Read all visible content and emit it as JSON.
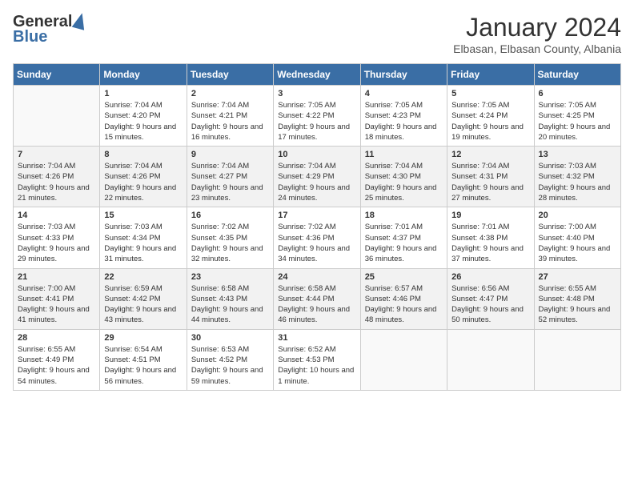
{
  "header": {
    "logo_general": "General",
    "logo_blue": "Blue",
    "title": "January 2024",
    "subtitle": "Elbasan, Elbasan County, Albania"
  },
  "weekdays": [
    "Sunday",
    "Monday",
    "Tuesday",
    "Wednesday",
    "Thursday",
    "Friday",
    "Saturday"
  ],
  "weeks": [
    [
      {
        "day": "",
        "sunrise": "",
        "sunset": "",
        "daylight": ""
      },
      {
        "day": "1",
        "sunrise": "Sunrise: 7:04 AM",
        "sunset": "Sunset: 4:20 PM",
        "daylight": "Daylight: 9 hours and 15 minutes."
      },
      {
        "day": "2",
        "sunrise": "Sunrise: 7:04 AM",
        "sunset": "Sunset: 4:21 PM",
        "daylight": "Daylight: 9 hours and 16 minutes."
      },
      {
        "day": "3",
        "sunrise": "Sunrise: 7:05 AM",
        "sunset": "Sunset: 4:22 PM",
        "daylight": "Daylight: 9 hours and 17 minutes."
      },
      {
        "day": "4",
        "sunrise": "Sunrise: 7:05 AM",
        "sunset": "Sunset: 4:23 PM",
        "daylight": "Daylight: 9 hours and 18 minutes."
      },
      {
        "day": "5",
        "sunrise": "Sunrise: 7:05 AM",
        "sunset": "Sunset: 4:24 PM",
        "daylight": "Daylight: 9 hours and 19 minutes."
      },
      {
        "day": "6",
        "sunrise": "Sunrise: 7:05 AM",
        "sunset": "Sunset: 4:25 PM",
        "daylight": "Daylight: 9 hours and 20 minutes."
      }
    ],
    [
      {
        "day": "7",
        "sunrise": "Sunrise: 7:04 AM",
        "sunset": "Sunset: 4:26 PM",
        "daylight": "Daylight: 9 hours and 21 minutes."
      },
      {
        "day": "8",
        "sunrise": "Sunrise: 7:04 AM",
        "sunset": "Sunset: 4:26 PM",
        "daylight": "Daylight: 9 hours and 22 minutes."
      },
      {
        "day": "9",
        "sunrise": "Sunrise: 7:04 AM",
        "sunset": "Sunset: 4:27 PM",
        "daylight": "Daylight: 9 hours and 23 minutes."
      },
      {
        "day": "10",
        "sunrise": "Sunrise: 7:04 AM",
        "sunset": "Sunset: 4:29 PM",
        "daylight": "Daylight: 9 hours and 24 minutes."
      },
      {
        "day": "11",
        "sunrise": "Sunrise: 7:04 AM",
        "sunset": "Sunset: 4:30 PM",
        "daylight": "Daylight: 9 hours and 25 minutes."
      },
      {
        "day": "12",
        "sunrise": "Sunrise: 7:04 AM",
        "sunset": "Sunset: 4:31 PM",
        "daylight": "Daylight: 9 hours and 27 minutes."
      },
      {
        "day": "13",
        "sunrise": "Sunrise: 7:03 AM",
        "sunset": "Sunset: 4:32 PM",
        "daylight": "Daylight: 9 hours and 28 minutes."
      }
    ],
    [
      {
        "day": "14",
        "sunrise": "Sunrise: 7:03 AM",
        "sunset": "Sunset: 4:33 PM",
        "daylight": "Daylight: 9 hours and 29 minutes."
      },
      {
        "day": "15",
        "sunrise": "Sunrise: 7:03 AM",
        "sunset": "Sunset: 4:34 PM",
        "daylight": "Daylight: 9 hours and 31 minutes."
      },
      {
        "day": "16",
        "sunrise": "Sunrise: 7:02 AM",
        "sunset": "Sunset: 4:35 PM",
        "daylight": "Daylight: 9 hours and 32 minutes."
      },
      {
        "day": "17",
        "sunrise": "Sunrise: 7:02 AM",
        "sunset": "Sunset: 4:36 PM",
        "daylight": "Daylight: 9 hours and 34 minutes."
      },
      {
        "day": "18",
        "sunrise": "Sunrise: 7:01 AM",
        "sunset": "Sunset: 4:37 PM",
        "daylight": "Daylight: 9 hours and 36 minutes."
      },
      {
        "day": "19",
        "sunrise": "Sunrise: 7:01 AM",
        "sunset": "Sunset: 4:38 PM",
        "daylight": "Daylight: 9 hours and 37 minutes."
      },
      {
        "day": "20",
        "sunrise": "Sunrise: 7:00 AM",
        "sunset": "Sunset: 4:40 PM",
        "daylight": "Daylight: 9 hours and 39 minutes."
      }
    ],
    [
      {
        "day": "21",
        "sunrise": "Sunrise: 7:00 AM",
        "sunset": "Sunset: 4:41 PM",
        "daylight": "Daylight: 9 hours and 41 minutes."
      },
      {
        "day": "22",
        "sunrise": "Sunrise: 6:59 AM",
        "sunset": "Sunset: 4:42 PM",
        "daylight": "Daylight: 9 hours and 43 minutes."
      },
      {
        "day": "23",
        "sunrise": "Sunrise: 6:58 AM",
        "sunset": "Sunset: 4:43 PM",
        "daylight": "Daylight: 9 hours and 44 minutes."
      },
      {
        "day": "24",
        "sunrise": "Sunrise: 6:58 AM",
        "sunset": "Sunset: 4:44 PM",
        "daylight": "Daylight: 9 hours and 46 minutes."
      },
      {
        "day": "25",
        "sunrise": "Sunrise: 6:57 AM",
        "sunset": "Sunset: 4:46 PM",
        "daylight": "Daylight: 9 hours and 48 minutes."
      },
      {
        "day": "26",
        "sunrise": "Sunrise: 6:56 AM",
        "sunset": "Sunset: 4:47 PM",
        "daylight": "Daylight: 9 hours and 50 minutes."
      },
      {
        "day": "27",
        "sunrise": "Sunrise: 6:55 AM",
        "sunset": "Sunset: 4:48 PM",
        "daylight": "Daylight: 9 hours and 52 minutes."
      }
    ],
    [
      {
        "day": "28",
        "sunrise": "Sunrise: 6:55 AM",
        "sunset": "Sunset: 4:49 PM",
        "daylight": "Daylight: 9 hours and 54 minutes."
      },
      {
        "day": "29",
        "sunrise": "Sunrise: 6:54 AM",
        "sunset": "Sunset: 4:51 PM",
        "daylight": "Daylight: 9 hours and 56 minutes."
      },
      {
        "day": "30",
        "sunrise": "Sunrise: 6:53 AM",
        "sunset": "Sunset: 4:52 PM",
        "daylight": "Daylight: 9 hours and 59 minutes."
      },
      {
        "day": "31",
        "sunrise": "Sunrise: 6:52 AM",
        "sunset": "Sunset: 4:53 PM",
        "daylight": "Daylight: 10 hours and 1 minute."
      },
      {
        "day": "",
        "sunrise": "",
        "sunset": "",
        "daylight": ""
      },
      {
        "day": "",
        "sunrise": "",
        "sunset": "",
        "daylight": ""
      },
      {
        "day": "",
        "sunrise": "",
        "sunset": "",
        "daylight": ""
      }
    ]
  ]
}
